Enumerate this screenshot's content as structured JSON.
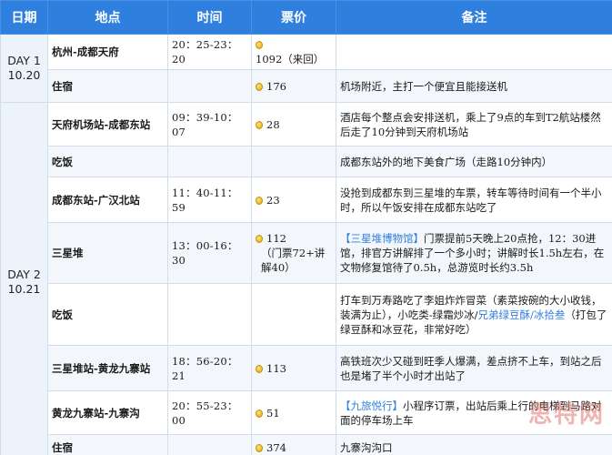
{
  "header": {
    "date": "日期",
    "place": "地点",
    "time": "时间",
    "price": "票价",
    "note": "备注"
  },
  "day1": {
    "label": "DAY 1",
    "date": "10.20",
    "rows": [
      {
        "place": "杭州-成都天府",
        "time": "20：25-23：20",
        "price": "1092（来回）",
        "note": ""
      },
      {
        "place": "住宿",
        "time": "",
        "price": "176",
        "note": "机场附近，主打一个便宜且能接送机"
      }
    ]
  },
  "day2": {
    "label": "DAY 2",
    "date": "10.21",
    "rows": [
      {
        "place": "天府机场站-成都东站",
        "time": "09：39-10：07",
        "price": "28",
        "note": "酒店每个整点会安排送机，乘上了9点的车到T2航站楼然后走了10分钟到天府机场站"
      },
      {
        "place": "吃饭",
        "time": "",
        "price": "",
        "note": "成都东站外的地下美食广场（走路10分钟内）"
      },
      {
        "place": "成都东站-广汉北站",
        "time": "11：40-11：59",
        "price": "23",
        "note": "没抢到成都东到三星堆的车票，转车等待时间有一个半小时，所以午饭安排在成都东站吃了"
      },
      {
        "place": "三星堆",
        "time": "13：00-16：30",
        "price": "112",
        "price_detail": "（门票72+讲解40）",
        "note_hl": "【三星堆博物馆】",
        "note": "门票提前5天晚上20点抢，12：30进馆，排官方讲解排了一个多小时；讲解时长1.5h左右，在文物修复馆待了0.5h，总游览时长约3.5h"
      },
      {
        "place": "吃饭",
        "time": "",
        "price": "",
        "note_a": "打车到万寿路吃了李姐炸炸冒菜（素菜按碗的大小收钱，装满为止），小吃类-绿霜炒冰/",
        "note_hl": "兄弟绿豆酥/冰拾叁",
        "note_b": "（打包了绿豆酥和冰豆花，非常好吃）"
      },
      {
        "place": "三星堆站-黄龙九寨站",
        "time": "18：56-20：21",
        "price": "113",
        "note": "高铁班次少又碰到旺季人爆满，差点挤不上车，到站之后也是堵了半个小时才出站了"
      },
      {
        "place": "黄龙九寨站-九寨沟",
        "time": "20：55-23：00",
        "price": "51",
        "note_hl": "【九旅悦行】",
        "note": "小程序订票，出站后乘上行的电梯到马路对面的停车场上车"
      },
      {
        "place": "住宿",
        "time": "",
        "price": "374",
        "note": "九寨沟沟口"
      }
    ]
  },
  "watermark": "思特网",
  "colors": {
    "header": "#2f7fde",
    "link": "#2f7fde",
    "date_bg": "#edf3fb"
  }
}
